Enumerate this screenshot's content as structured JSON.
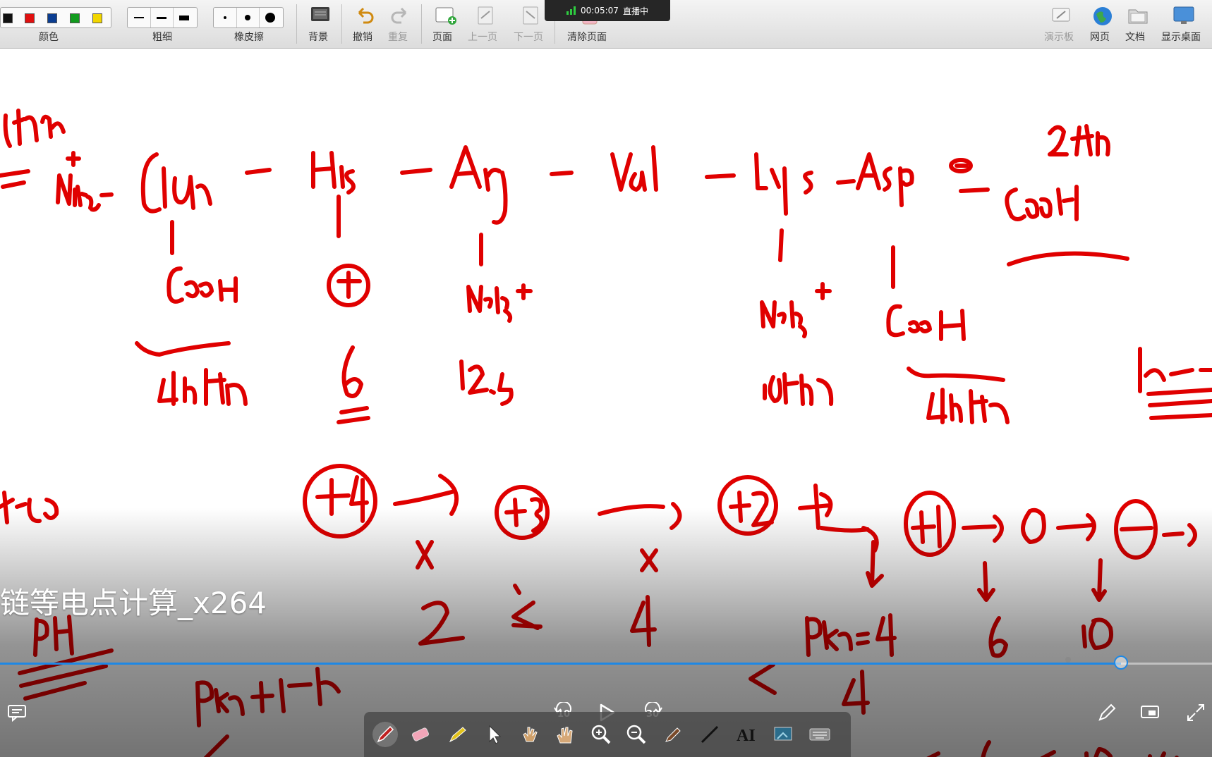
{
  "toolbar": {
    "color_label": "颜色",
    "thickness_label": "粗细",
    "eraser_label": "橡皮擦",
    "background_label": "背景",
    "undo_label": "撤销",
    "redo_label": "重复",
    "page_label": "页面",
    "prev_page_label": "上一页",
    "next_page_label": "下一页",
    "clear_page_label": "清除页面",
    "whiteboard_label": "演示板",
    "webpage_label": "网页",
    "document_label": "文档",
    "show_desktop_label": "显示桌面",
    "colors": [
      "#111111",
      "#e01010",
      "#0b3d91",
      "#129b1e",
      "#f2d600"
    ]
  },
  "live": {
    "timer": "00:05:07",
    "status": "直播中",
    "signal_color": "#2ecc40"
  },
  "video": {
    "title": "链等电点计算_x264",
    "progress_fraction": 0.925,
    "skip_back_seconds": "10",
    "skip_forward_seconds": "30",
    "accent": "#1e88e5"
  },
  "drawing_tools": [
    "pen-tool-icon",
    "eraser-tool-icon",
    "highlighter-tool-icon",
    "pointer-tool-icon",
    "laser-hand-icon",
    "grab-hand-icon",
    "zoom-in-icon",
    "zoom-out-icon",
    "marker-tool-icon",
    "line-tool-icon",
    "text-tool-icon",
    "screen-capture-icon",
    "keyboard-icon"
  ],
  "ink_color": "#e00000",
  "handwriting": {
    "peptide": [
      "NH3+",
      "Glu",
      "His",
      "Arg",
      "Val",
      "Lys",
      "Asp",
      "COOH"
    ],
    "side_chains": [
      "COOH",
      "⊕",
      "NH3+",
      "NH3+",
      "COOH"
    ],
    "pka_values": [
      "4",
      "6",
      "12.5",
      "10",
      "4"
    ],
    "charge_sequence": [
      "+4",
      "+3",
      "+2",
      "+1",
      "0",
      "-1"
    ],
    "bottom_values": [
      "2",
      "4",
      "pKa=4",
      "6",
      "10"
    ]
  }
}
